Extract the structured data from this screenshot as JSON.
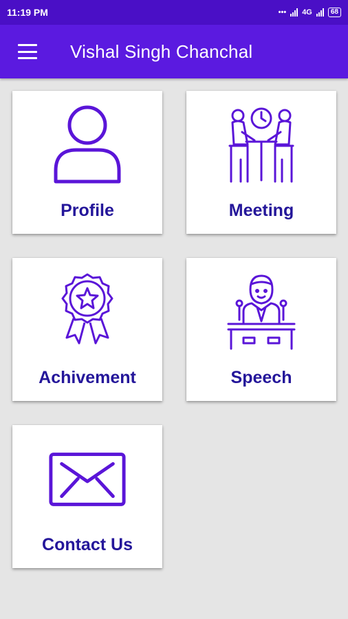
{
  "status_bar": {
    "time": "11:19 PM",
    "network_label": "4G",
    "battery_level": "68"
  },
  "app_bar": {
    "title": "Vishal Singh Chanchal",
    "menu_icon": "hamburger-menu-icon"
  },
  "colors": {
    "status_bar": "#4a0fc6",
    "app_bar": "#5b1ae0",
    "icon": "#5a15d8",
    "label": "#24169a",
    "background": "#e5e5e5"
  },
  "menu": {
    "items": [
      {
        "label": "Profile",
        "icon": "person-icon"
      },
      {
        "label": "Meeting",
        "icon": "meeting-icon"
      },
      {
        "label": "Achivement",
        "icon": "award-ribbon-icon"
      },
      {
        "label": "Speech",
        "icon": "speaker-podium-icon"
      },
      {
        "label": "Contact Us",
        "icon": "envelope-icon"
      }
    ]
  }
}
